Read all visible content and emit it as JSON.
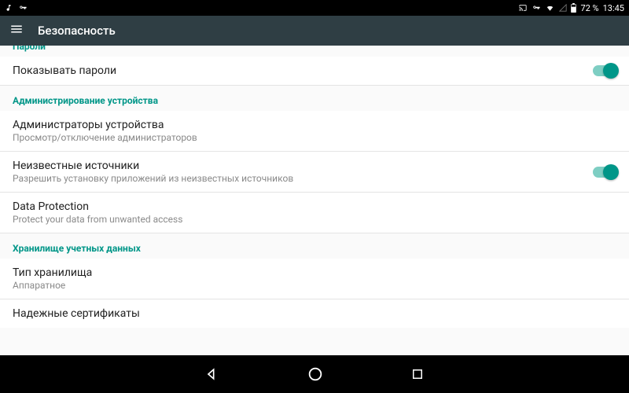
{
  "statusbar": {
    "battery": "72 %",
    "time": "13:45"
  },
  "appbar": {
    "title": "Безопасность"
  },
  "sections": {
    "passwords": {
      "header": "Пароли"
    },
    "admin": {
      "header": "Администрирование устройства"
    },
    "storage": {
      "header": "Хранилище учетных данных"
    }
  },
  "rows": {
    "show_passwords": {
      "title": "Показывать пароли"
    },
    "device_admins": {
      "title": "Администраторы устройства",
      "subtitle": "Просмотр/отключение администраторов"
    },
    "unknown_sources": {
      "title": "Неизвестные источники",
      "subtitle": "Разрешить установку приложений из неизвестных источников"
    },
    "data_protection": {
      "title": "Data Protection",
      "subtitle": "Protect your data from unwanted access"
    },
    "storage_type": {
      "title": "Тип хранилища",
      "subtitle": "Аппаратное"
    },
    "trusted_certs": {
      "title": "Надежные сертификаты"
    }
  }
}
